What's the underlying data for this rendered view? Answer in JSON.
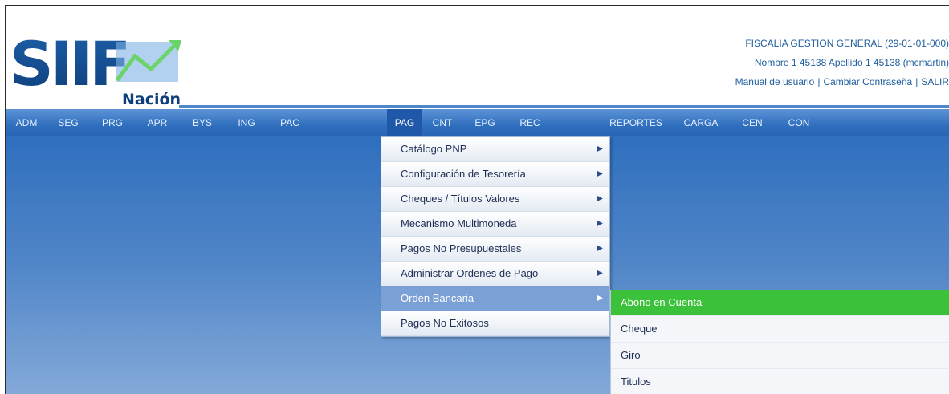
{
  "logo": {
    "text_main": "SIIF",
    "text_sub": "Nación"
  },
  "user": {
    "entity": "FISCALIA GESTION GENERAL (29-01-01-000)",
    "name": "Nombre 1 45138 Apellido 1 45138 (mcmartin)",
    "manual_link": "Manual de usuario",
    "sep1": "|",
    "password_link": "Cambiar Contraseña",
    "sep2": "|",
    "logout_link": "SALIR"
  },
  "menu": [
    "ADM",
    "SEG",
    "PRG",
    "APR",
    "BYS",
    "ING",
    "PAC",
    "PAG",
    "CNT",
    "EPG",
    "REC",
    "REPORTES",
    "CARGA",
    "CEN",
    "CON"
  ],
  "dropdown": [
    {
      "label": "Catálogo PNP",
      "arrow": "▶"
    },
    {
      "label": "Configuración de Tesorería",
      "arrow": "▶"
    },
    {
      "label": "Cheques / Títulos Valores",
      "arrow": "▶"
    },
    {
      "label": "Mecanismo Multimoneda",
      "arrow": "▶"
    },
    {
      "label": "Pagos No Presupuestales",
      "arrow": "▶"
    },
    {
      "label": "Administrar Ordenes de Pago",
      "arrow": "▶"
    },
    {
      "label": "Orden Bancaria",
      "arrow": "▶"
    },
    {
      "label": "Pagos No Exitosos",
      "arrow": ""
    }
  ],
  "submenu": [
    "Abono en Cuenta",
    "Cheque",
    "Giro",
    "Titulos"
  ],
  "colors": {
    "menubar": "#2f6fbe",
    "highlight": "#3cc13b",
    "link": "#1f5e9e"
  }
}
